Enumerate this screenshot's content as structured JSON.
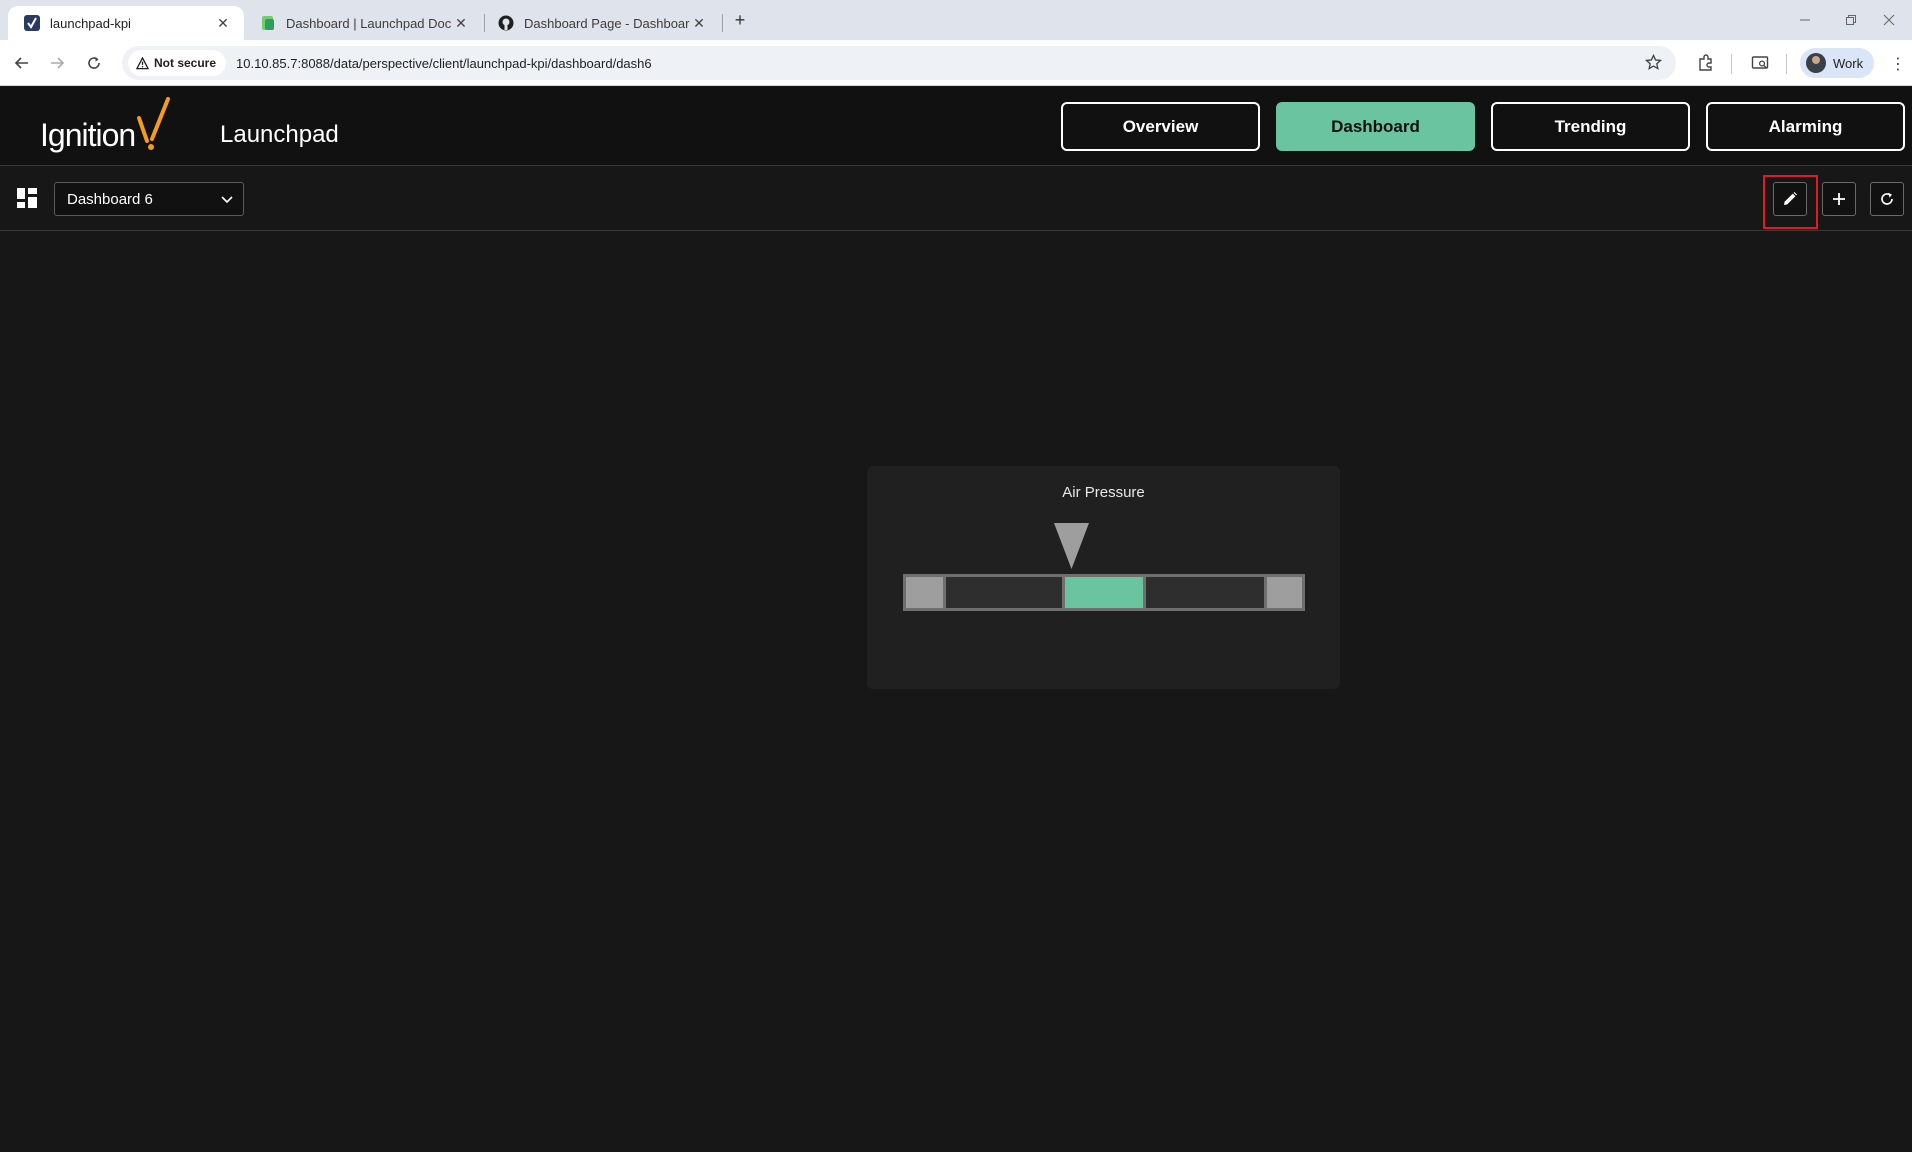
{
  "browser": {
    "tabs": [
      {
        "title": "launchpad-kpi",
        "active": true
      },
      {
        "title": "Dashboard | Launchpad Docum",
        "active": false
      },
      {
        "title": "Dashboard Page - Dashboard A",
        "active": false
      }
    ],
    "security_label": "Not secure",
    "url": "10.10.85.7:8088/data/perspective/client/launchpad-kpi/dashboard/dash6",
    "profile_name": "Work"
  },
  "app": {
    "logo_text": "Ignition",
    "title": "Launchpad",
    "nav": [
      {
        "label": "Overview",
        "active": false
      },
      {
        "label": "Dashboard",
        "active": true
      },
      {
        "label": "Trending",
        "active": false
      },
      {
        "label": "Alarming",
        "active": false
      }
    ],
    "accent_color": "#6bc4a0"
  },
  "dashboard": {
    "selected": "Dashboard 6",
    "actions": [
      "edit-icon",
      "add-icon",
      "refresh-icon"
    ]
  },
  "widget": {
    "title": "Air Pressure",
    "zone_colors": [
      "#9e9e9e",
      "#2e2e2e",
      "#6bc4a0",
      "#2e2e2e",
      "#9e9e9e"
    ]
  }
}
